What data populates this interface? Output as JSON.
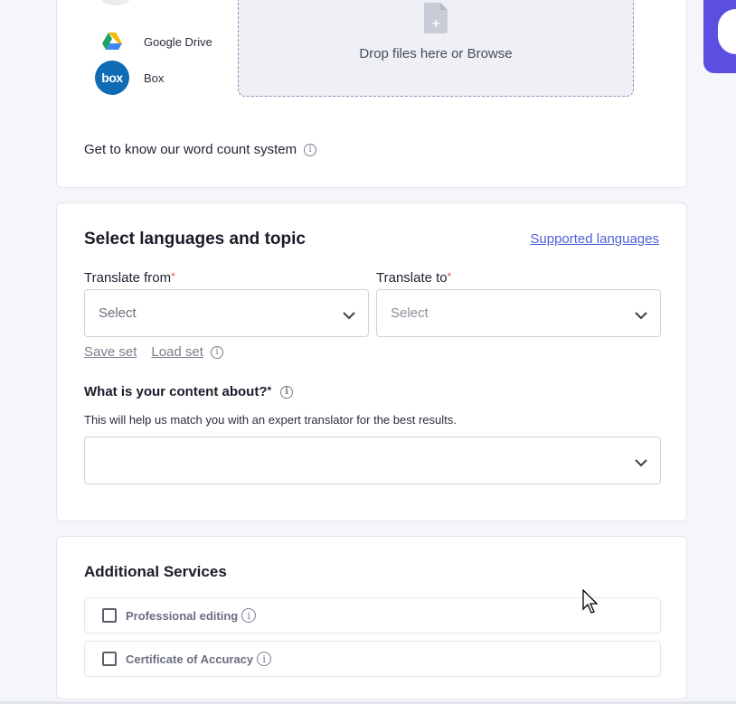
{
  "upload": {
    "sources": [
      {
        "name": "Google Drive",
        "icon": "google-drive-icon"
      },
      {
        "name": "Box",
        "icon": "box-icon",
        "logo_text": "box"
      }
    ],
    "dropzone_text": "Drop files here or Browse",
    "word_count_text": "Get to know our word count system"
  },
  "languages": {
    "title": "Select languages and topic",
    "supported_link": "Supported languages",
    "from": {
      "label": "Translate from",
      "required_mark": "*",
      "placeholder": "Select"
    },
    "to": {
      "label": "Translate to",
      "required_mark": "*",
      "placeholder": "Select"
    },
    "save_set": "Save set",
    "load_set": "Load set",
    "content_question": "What is your content about?",
    "content_required_mark": "*",
    "content_help": "This will help us match you with an expert translator for the best results.",
    "content_value": ""
  },
  "services": {
    "title": "Additional Services",
    "items": [
      {
        "label": "Professional editing",
        "checked": false
      },
      {
        "label": "Certificate of Accuracy",
        "checked": false
      }
    ]
  },
  "colors": {
    "accent": "#5a4fe0",
    "link": "#4e5fd6",
    "required": "#e0544c"
  }
}
